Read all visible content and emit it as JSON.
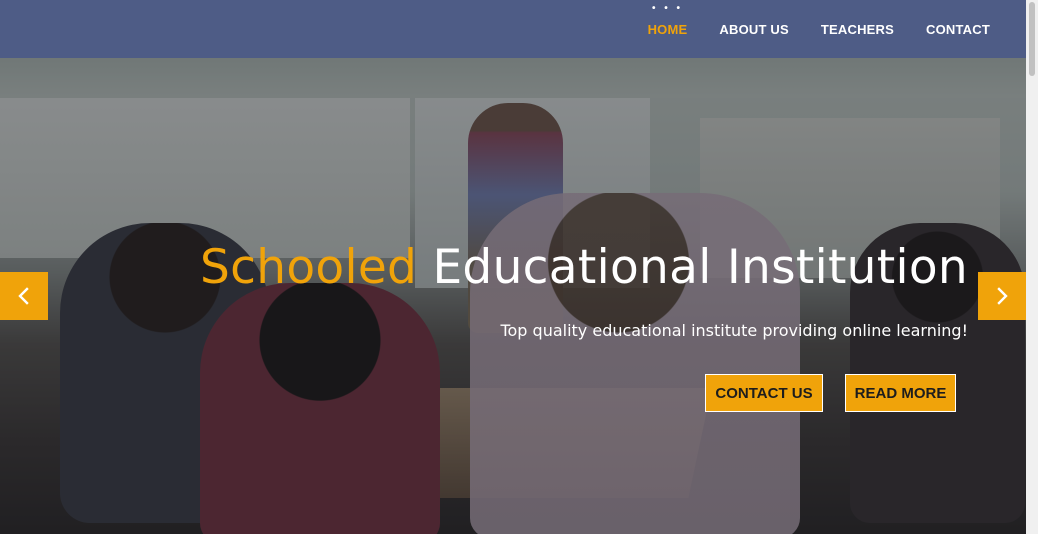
{
  "nav": {
    "items": [
      {
        "label": "HOME",
        "active": true
      },
      {
        "label": "ABOUT US",
        "active": false
      },
      {
        "label": "TEACHERS",
        "active": false
      },
      {
        "label": "CONTACT",
        "active": false
      }
    ],
    "dots": "• • •"
  },
  "hero": {
    "title_accent": "Schooled",
    "title_rest": "Educational Institution",
    "subtitle": "Top quality educational institute providing online learning!",
    "buttons": {
      "contact": "CONTACT US",
      "read_more": "READ MORE"
    },
    "prev_icon": "chevron-left-icon",
    "next_icon": "chevron-right-icon"
  },
  "colors": {
    "header_bg": "#4e5c86",
    "accent": "#f0a30a",
    "text": "#ffffff"
  }
}
